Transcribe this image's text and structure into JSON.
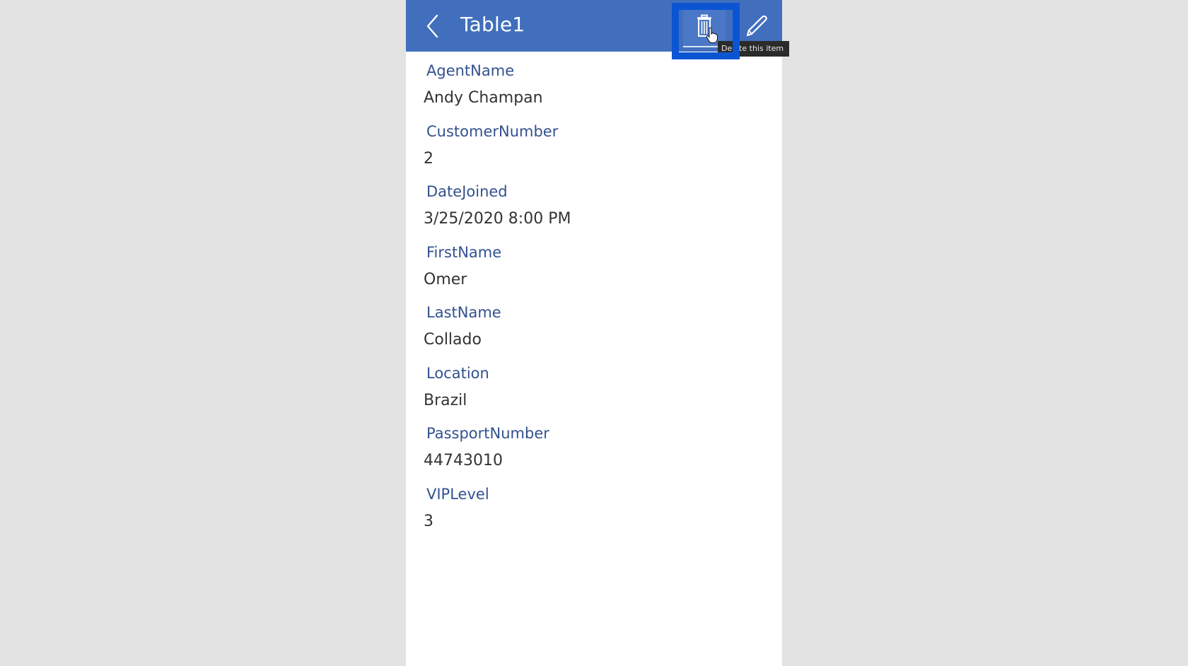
{
  "header": {
    "title": "Table1",
    "back_icon": "chevron-left-icon",
    "delete_icon": "trash-icon",
    "edit_icon": "pencil-icon",
    "tooltip": "Delete this item"
  },
  "colors": {
    "header_bg": "#416fbd",
    "highlight": "#0b55d3",
    "label": "#33518f",
    "value": "#333333",
    "background": "#e3e3e3"
  },
  "fields": [
    {
      "label": "AgentName",
      "value": "Andy Champan"
    },
    {
      "label": "CustomerNumber",
      "value": "2"
    },
    {
      "label": "DateJoined",
      "value": "3/25/2020 8:00 PM"
    },
    {
      "label": "FirstName",
      "value": "Omer"
    },
    {
      "label": "LastName",
      "value": "Collado"
    },
    {
      "label": "Location",
      "value": "Brazil"
    },
    {
      "label": "PassportNumber",
      "value": "44743010"
    },
    {
      "label": "VIPLevel",
      "value": "3"
    }
  ]
}
